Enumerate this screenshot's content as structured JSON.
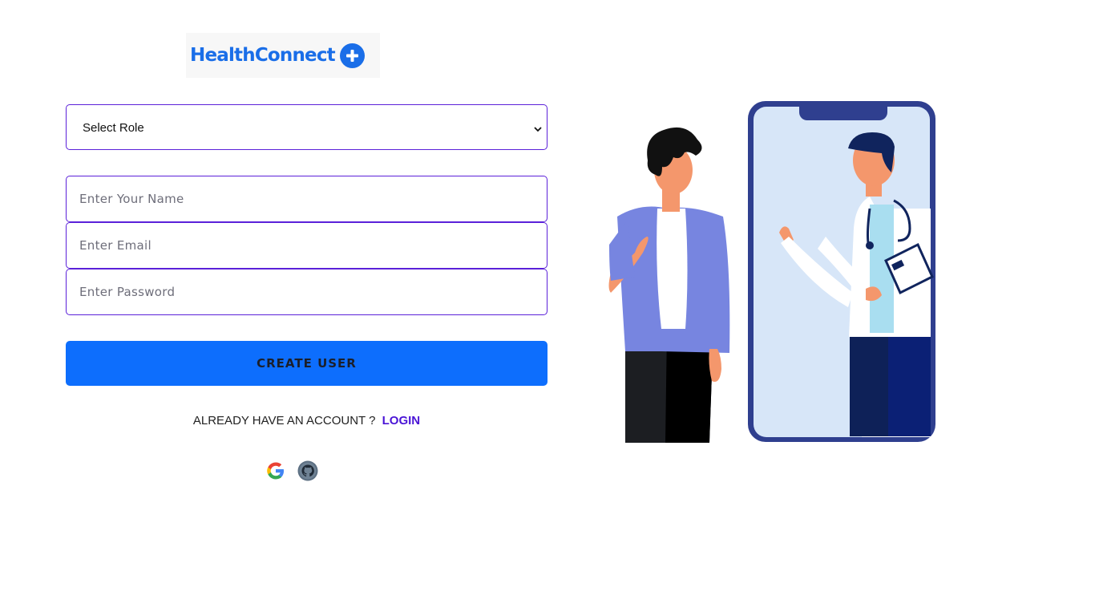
{
  "brand": {
    "name": "HealthConnect",
    "accent": "#1a6ee8"
  },
  "form": {
    "role_select": {
      "selected": "Select Role"
    },
    "name_input": {
      "placeholder": "Enter Your Name",
      "value": ""
    },
    "email_input": {
      "placeholder": "Enter Email",
      "value": ""
    },
    "password_input": {
      "placeholder": "Enter Password",
      "value": ""
    },
    "submit_label": "CREATE USER",
    "border_color": "#5b21d9",
    "button_color": "#0d6efd"
  },
  "account": {
    "prompt": "ALREADY HAVE AN ACCOUNT ?",
    "login_label": "LOGIN",
    "login_color": "#4a14d6"
  },
  "social": {
    "icons": [
      "google-icon",
      "github-icon"
    ]
  },
  "illustration": {
    "icon": "doctor-patient-video-call-illustration"
  }
}
